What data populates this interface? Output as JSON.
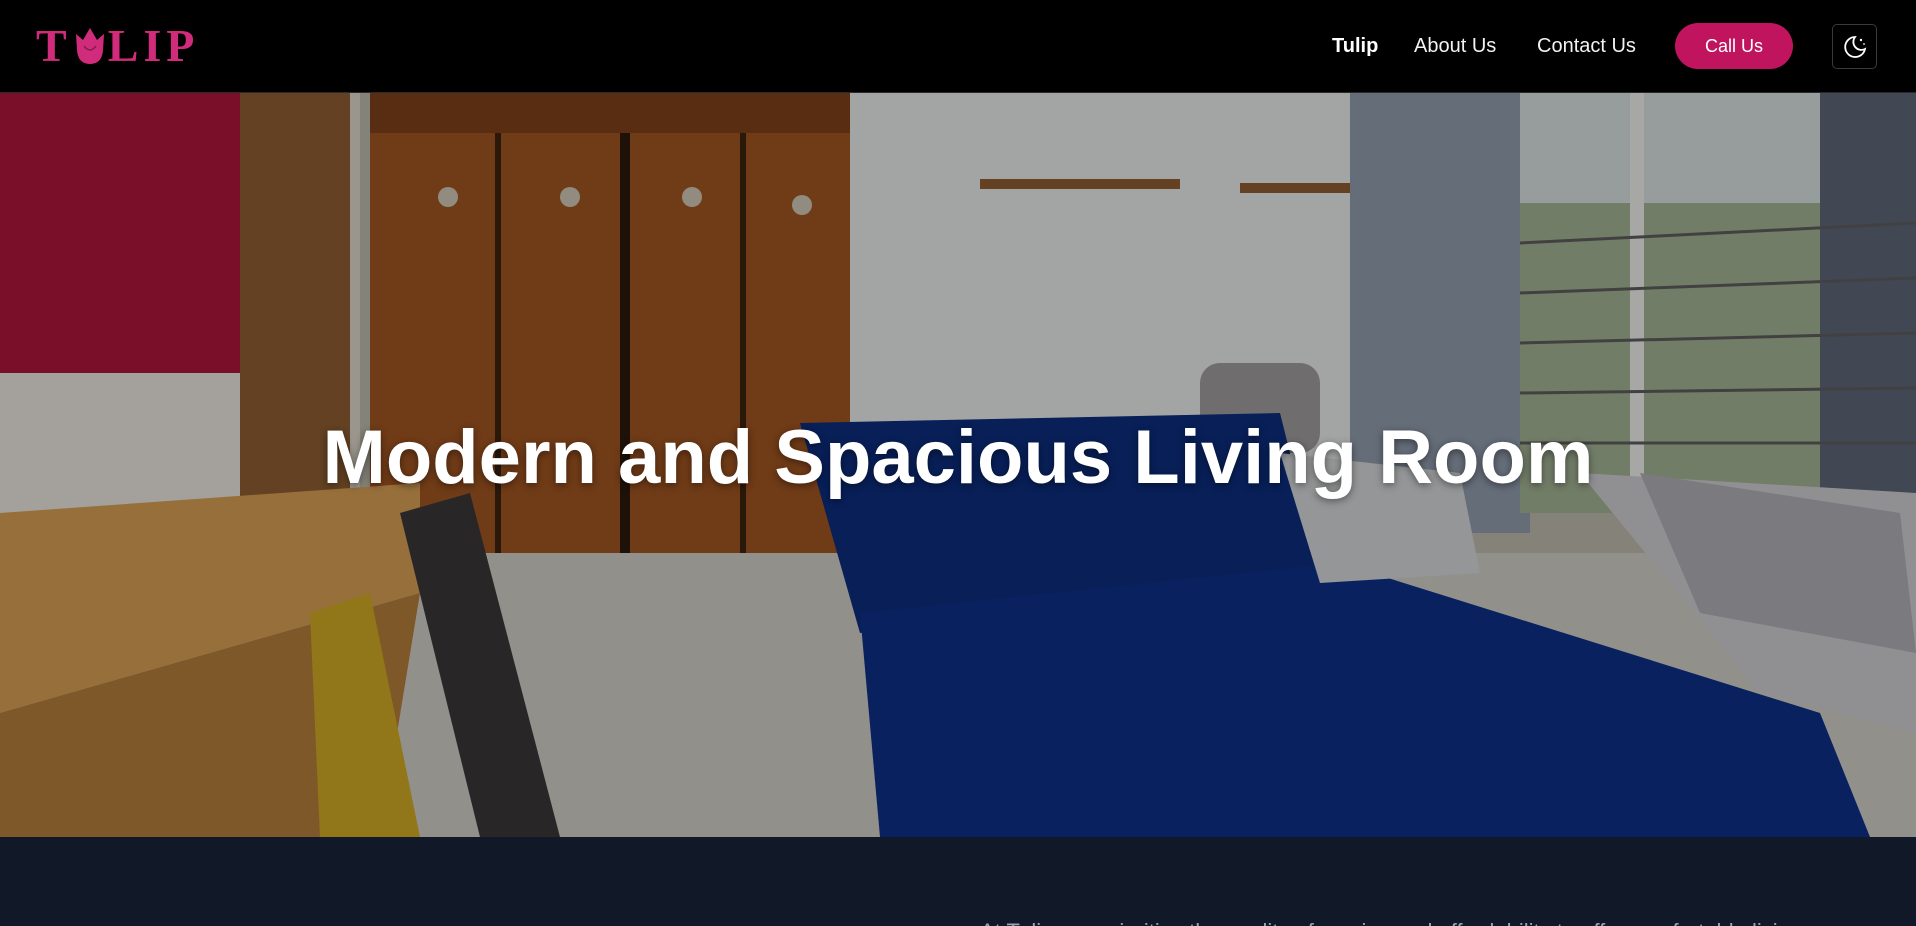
{
  "brand": {
    "name": "TULIP",
    "logo_prefix": "T",
    "logo_suffix": "LIP",
    "color": "#d12c7b"
  },
  "nav": {
    "links": [
      {
        "label": "Tulip",
        "active": true
      },
      {
        "label": "About Us",
        "active": false
      },
      {
        "label": "Contact Us",
        "active": false
      }
    ],
    "call_button": "Call Us",
    "call_button_color": "#c0155e",
    "theme_toggle_icon": "moon-icon"
  },
  "hero": {
    "title": "Modern and Spacious Living Room",
    "image": "hostel-room-photo"
  },
  "content": {
    "intro": "At Tulip, we prioritize the quality of service and affordability to offer comfortable living spaces and"
  }
}
